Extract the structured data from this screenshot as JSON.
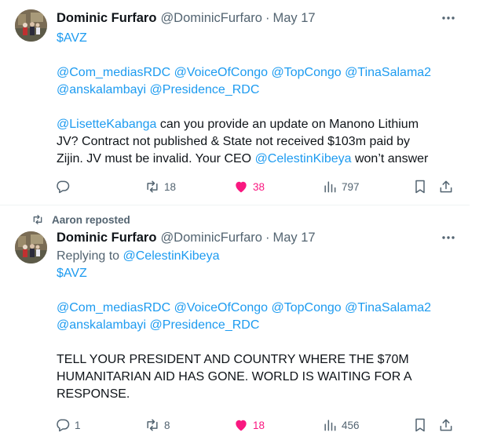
{
  "tweets": [
    {
      "author": {
        "name": "Dominic Furfaro",
        "handle": "@DominicFurfaro",
        "date": "May 17"
      },
      "lines": {
        "cashtag": "$AVZ",
        "mentions1": [
          "@Com_mediasRDC",
          "@VoiceOfCongo",
          "@TopCongo",
          "@TinaSalama2"
        ],
        "mentions2": [
          "@anskalambayi",
          "@Presidence_RDC"
        ],
        "p2_mention": "@LisetteKabanga",
        "p2_text1": " can you provide an update on Manono Lithium",
        "p2_text2": "JV? Contract not published & State not received $103m paid by",
        "p2_text3a": "Zijin. JV must be invalid. Your CEO ",
        "p2_mention2": "@CelestinKibeya",
        "p2_text3b": " won’t answer"
      },
      "stats": {
        "replies": "",
        "reposts": "18",
        "likes": "38",
        "views": "797"
      }
    },
    {
      "social_context": "Aaron reposted",
      "author": {
        "name": "Dominic Furfaro",
        "handle": "@DominicFurfaro",
        "date": "May 17"
      },
      "replying_to_label": "Replying to",
      "replying_to": "@CelestinKibeya",
      "lines": {
        "cashtag": "$AVZ",
        "mentions1": [
          "@Com_mediasRDC",
          "@VoiceOfCongo",
          "@TopCongo",
          "@TinaSalama2"
        ],
        "mentions2": [
          "@anskalambayi",
          "@Presidence_RDC"
        ],
        "text1": "TELL YOUR PRESIDENT AND COUNTRY WHERE THE $70M",
        "text2": "HUMANITARIAN AID HAS GONE. WORLD IS WAITING FOR A",
        "text3": "RESPONSE."
      },
      "stats": {
        "replies": "1",
        "reposts": "8",
        "likes": "18",
        "views": "456"
      }
    }
  ],
  "icons": {
    "reply": "reply-icon",
    "repost": "repost-icon",
    "like": "heart-icon",
    "views": "views-icon",
    "bookmark": "bookmark-icon",
    "share": "share-icon",
    "more": "more-icon"
  },
  "colors": {
    "link": "#1d9bf0",
    "muted": "#536471",
    "like": "#f91880",
    "text": "#0f1419"
  }
}
